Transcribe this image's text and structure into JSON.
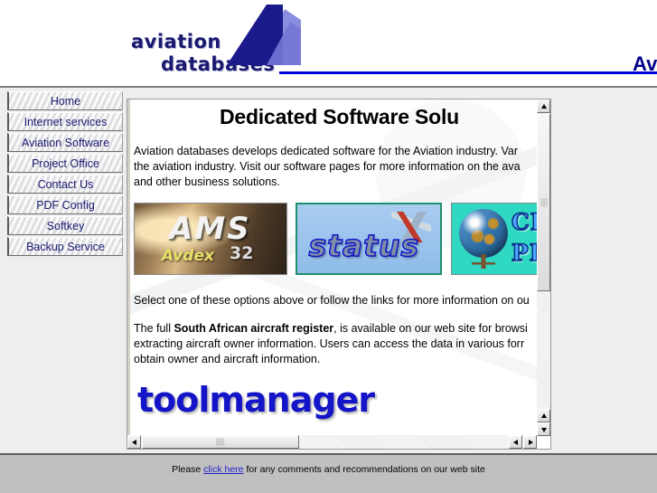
{
  "header": {
    "logo_line1": "aviation",
    "logo_line2": "databases",
    "title_truncated": "Av",
    "rule_color": "#0000dd",
    "logo_color": "#191970"
  },
  "menu": {
    "items": [
      {
        "label": "Home"
      },
      {
        "label": "Internet services"
      },
      {
        "label": "Aviation Software"
      },
      {
        "label": "Project Office"
      },
      {
        "label": "Contact Us"
      },
      {
        "label": "PDF Config"
      },
      {
        "label": "Softkey"
      },
      {
        "label": "Backup Service"
      }
    ]
  },
  "content": {
    "heading": "Dedicated Software Solu",
    "intro_line1": "Aviation databases develops dedicated software for the Aviation industry. Var",
    "intro_line2": "the aviation industry.  Visit our software pages for more information on the ava",
    "intro_line3": "and other business solutions.",
    "select_line": "Select one of these options above or follow the links for more information on ou",
    "register_line1_pre": "The full ",
    "register_line1_bold": "South African aircraft register",
    "register_line1_post": ", is available on our web site for browsi",
    "register_line2": "extracting aircraft owner information.  Users can access the data in various forr",
    "register_line3": "obtain owner and aircraft information.",
    "toolmanager": "toolmanager",
    "banners": [
      {
        "name": "ams",
        "title": "AMS",
        "sub": "Avdex",
        "version": "32",
        "bg": "#6b5336"
      },
      {
        "name": "status",
        "title": "status",
        "bg": "#9cc4ee",
        "border": "#1f8f6f"
      },
      {
        "name": "chart-planner",
        "line1": "CHAR",
        "line2": "PLAN",
        "bg": "#2fd8c2"
      }
    ]
  },
  "scrollbars": {
    "vertical": {
      "up_icon": "triangle-up-icon",
      "down_icon": "triangle-down-icon"
    },
    "horizontal": {
      "left_icon": "triangle-left-icon",
      "right_icon": "triangle-right-icon"
    }
  },
  "footer": {
    "text_before": "Please ",
    "link": "click here",
    "text_after": " for any comments and recommendations on our web site"
  }
}
